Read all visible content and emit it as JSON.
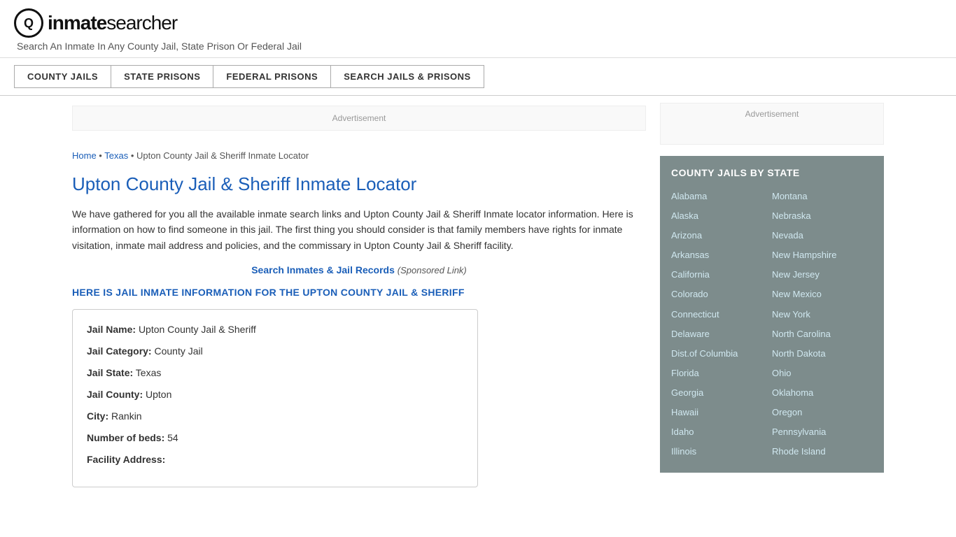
{
  "header": {
    "logo_letter": "Q",
    "site_name_bold": "inmate",
    "site_name_light": "searcher",
    "tagline": "Search An Inmate In Any County Jail, State Prison Or Federal Jail"
  },
  "nav": {
    "items": [
      {
        "label": "COUNTY JAILS",
        "href": "#"
      },
      {
        "label": "STATE PRISONS",
        "href": "#"
      },
      {
        "label": "FEDERAL PRISONS",
        "href": "#"
      },
      {
        "label": "SEARCH JAILS & PRISONS",
        "href": "#"
      }
    ]
  },
  "breadcrumb": {
    "home": "Home",
    "state": "Texas",
    "current": "Upton County Jail & Sheriff Inmate Locator"
  },
  "page": {
    "title": "Upton County Jail & Sheriff Inmate Locator",
    "body": "We have gathered for you all the available inmate search links and Upton County Jail & Sheriff Inmate locator information. Here is information on how to find someone in this jail. The first thing you should consider is that family members have rights for inmate visitation, inmate mail address and policies, and the commissary in Upton County Jail & Sheriff facility.",
    "sponsored_link_text": "Search Inmates & Jail Records",
    "sponsored_label": "(Sponsored Link)",
    "section_heading": "HERE IS JAIL INMATE INFORMATION FOR THE UPTON COUNTY JAIL & SHERIFF",
    "info": {
      "jail_name_label": "Jail Name:",
      "jail_name_value": "Upton County Jail & Sheriff",
      "jail_category_label": "Jail Category:",
      "jail_category_value": "County Jail",
      "jail_state_label": "Jail State:",
      "jail_state_value": "Texas",
      "jail_county_label": "Jail County:",
      "jail_county_value": "Upton",
      "city_label": "City:",
      "city_value": "Rankin",
      "beds_label": "Number of beds:",
      "beds_value": "54",
      "address_label": "Facility Address:"
    }
  },
  "sidebar": {
    "ad_label": "Advertisement",
    "county_jails_title": "COUNTY JAILS BY STATE",
    "states_col1": [
      "Alabama",
      "Alaska",
      "Arizona",
      "Arkansas",
      "California",
      "Colorado",
      "Connecticut",
      "Delaware",
      "Dist.of Columbia",
      "Florida",
      "Georgia",
      "Hawaii",
      "Idaho",
      "Illinois"
    ],
    "states_col2": [
      "Montana",
      "Nebraska",
      "Nevada",
      "New Hampshire",
      "New Jersey",
      "New Mexico",
      "New York",
      "North Carolina",
      "North Dakota",
      "Ohio",
      "Oklahoma",
      "Oregon",
      "Pennsylvania",
      "Rhode Island"
    ]
  },
  "ad_top_label": "Advertisement"
}
